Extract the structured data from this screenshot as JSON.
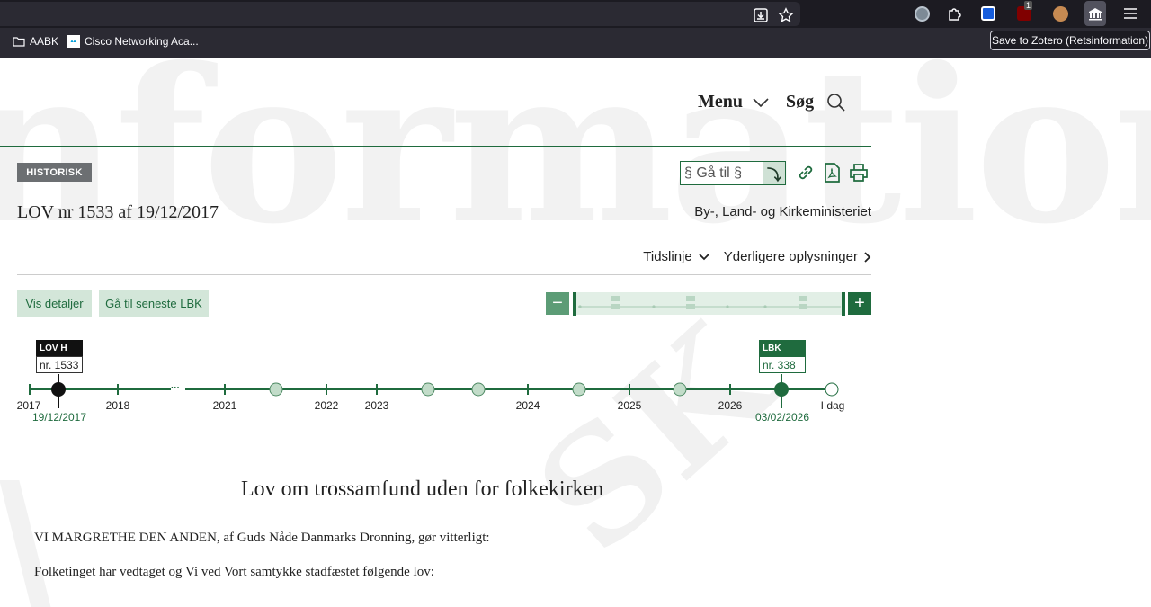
{
  "browser": {
    "bookmarks": [
      {
        "label": "AABK",
        "icon": "folder-icon"
      },
      {
        "label": "Cisco Networking Aca...",
        "icon": "cisco-icon"
      }
    ],
    "extension_badge": "1",
    "tooltip": "Save to Zotero (Retsinformation)"
  },
  "watermark": "nformation",
  "watermark2": "SK",
  "nav": {
    "menu_label": "Menu",
    "search_label": "Søg"
  },
  "doc": {
    "status_badge": "HISTORISK",
    "goto_placeholder": "§ Gå til §",
    "goto_button": "⤵",
    "title": "LOV nr 1533 af 19/12/2017",
    "ministry": "By-, Land- og Kirkeministeriet",
    "timeline_toggle": "Tidslinje",
    "more_info": "Yderligere oplysninger",
    "show_details": "Vis detaljer",
    "goto_latest": "Gå til seneste LBK",
    "zoom_minus": "−",
    "zoom_plus": "+"
  },
  "timeline": {
    "years": [
      "2017",
      "2018",
      "2021",
      "2022",
      "2023",
      "2024",
      "2025",
      "2026",
      "I dag"
    ],
    "left_flag": {
      "type": "LOV H",
      "number": "nr. 1533",
      "date": "19/12/2017"
    },
    "right_flag": {
      "type": "LBK",
      "number": "nr. 338",
      "date": "03/02/2026"
    },
    "gap_marker": "···"
  },
  "content": {
    "heading": "Lov om trossamfund uden for folkekirken",
    "para1": "VI MARGRETHE DEN ANDEN, af Guds Nåde Danmarks Dronning, gør vitterligt:",
    "para2": "Folketinget har vedtaget og Vi ved Vort samtykke stadfæstet følgende lov:"
  },
  "colors": {
    "accent": "#1f6b3e",
    "accent_light": "#d3e6d9",
    "badge_grey": "#6c6f72",
    "chrome_dark": "#1c1b22",
    "chrome_bar": "#2b2a33"
  }
}
